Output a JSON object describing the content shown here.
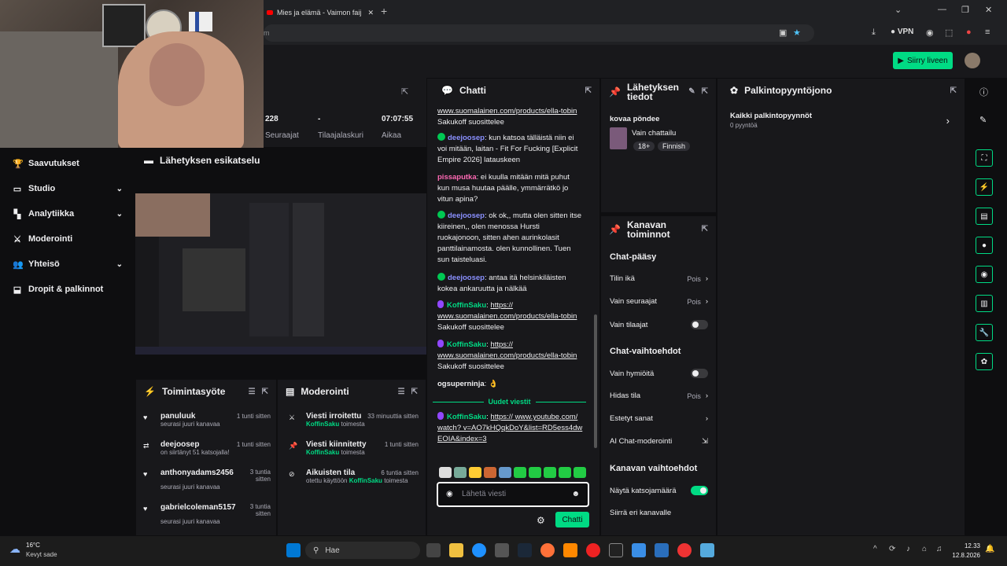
{
  "browser": {
    "tab_title": "Mies ja elämä - Vaimon faij",
    "url": "m",
    "vpn_label": "VPN"
  },
  "header": {
    "go_live": "Siirry liveen"
  },
  "nav": {
    "items": [
      {
        "label": "Saavutukset",
        "icon": "trophy-icon"
      },
      {
        "label": "Studio",
        "icon": "studio-icon"
      },
      {
        "label": "Analytiikka",
        "icon": "analytics-icon"
      },
      {
        "label": "Moderointi",
        "icon": "sword-icon"
      },
      {
        "label": "Yhteisö",
        "icon": "community-icon"
      },
      {
        "label": "Dropit & palkinnot",
        "icon": "drops-icon"
      }
    ]
  },
  "stats": [
    {
      "value": "228",
      "label": "Seuraajat"
    },
    {
      "value": "-",
      "label": "Tilaajalaskuri"
    },
    {
      "value": "07:07:55",
      "label": "Aikaa"
    }
  ],
  "preview": {
    "title": "Lähetyksen esikatselu"
  },
  "activity": {
    "title": "Toimintasyöte",
    "items": [
      {
        "name": "panuluuk",
        "sub": "seurasi juuri kanavaa",
        "time": "1 tunti sitten",
        "icon": "heart-icon"
      },
      {
        "name": "deejoosep",
        "sub": "on siirtänyt 51 katsojalla!",
        "time": "1 tunti sitten",
        "icon": "raid-icon"
      },
      {
        "name": "anthonyadams2456",
        "sub": "seurasi juuri kanavaa",
        "time": "3 tuntia sitten",
        "icon": "heart-icon"
      },
      {
        "name": "gabrielcoleman5157",
        "sub": "seurasi juuri kanavaa",
        "time": "3 tuntia sitten",
        "icon": "heart-icon"
      }
    ]
  },
  "moderation": {
    "title": "Moderointi",
    "items": [
      {
        "title": "Viesti irroitettu",
        "time": "33 minuuttia sitten",
        "actor": "KoffinSaku",
        "suffix": "toimesta"
      },
      {
        "title": "Viesti kiinnitetty",
        "time": "1 tunti sitten",
        "actor": "KoffinSaku",
        "suffix": "toimesta"
      },
      {
        "title": "Aikuisten tila",
        "time": "6 tuntia sitten",
        "actor": "KoffinSaku",
        "prefix": "otettu käyttöön",
        "suffix": "toimesta"
      }
    ]
  },
  "chat": {
    "title": "Chatti",
    "msg0": {
      "link": "www.suomalainen.com/products/ella-tobin",
      "text": " Sakukoff suosittelee"
    },
    "msg1": {
      "user": "deejoosep",
      "text": "kun katsoa tälläistä niin ei voi mitään, laitan - Fit For Fucking [Explicit Empire 2026] latauskeen"
    },
    "msg2": {
      "user": "pissaputka",
      "text": "ei kuulla mitään mitä puhut kun musa huutaa päälle, ymmärrätkö jo vitun apina?"
    },
    "msg3": {
      "user": "deejoosep",
      "text": "ok ok,, mutta olen sitten itse kiireinen,, olen menossa Hursti ruokajonoon, sitten ahen aurinkolasit panttilainamosta. olen kunnollinen. Tuen sun taisteluasi."
    },
    "msg4": {
      "user": "deejoosep",
      "text": "antaa itä helsinkiläisten kokea ankaruutta ja nälkää"
    },
    "msg5": {
      "user": "KoffinSaku",
      "link": "https:// www.suomalainen.com/products/ella-tobin",
      "text": " Sakukoff suosittelee"
    },
    "msg6": {
      "user": "KoffinSaku",
      "link": "https:// www.suomalainen.com/products/ella-tobin",
      "text": " Sakukoff suosittelee"
    },
    "msg7": {
      "user": "ogsuperninja",
      "text": "👌"
    },
    "new_messages": "Uudet viestit",
    "msg8": {
      "user": "KoffinSaku",
      "link": "https:// www.youtube.com/watch? v=AO7kHQqkDoY&list=RD5ess4dwEOIA&index=3"
    },
    "placeholder": "Lähetä viesti",
    "send": "Chatti"
  },
  "stream_info": {
    "title": "Lähetyksen tiedot",
    "stream_title": "kovaa pöndee",
    "category": "Vain chattailu",
    "tags": [
      "18+",
      "Finnish"
    ]
  },
  "channel_actions": {
    "title": "Kanavan toiminnot",
    "sections": [
      {
        "title": "Chat-pääsy",
        "rows": [
          {
            "label": "Tilin ikä",
            "value": "Pois",
            "kind": "arrow"
          },
          {
            "label": "Vain seuraajat",
            "value": "Pois",
            "kind": "arrow"
          },
          {
            "label": "Vain tilaajat",
            "value": "",
            "kind": "toggle-off"
          }
        ]
      },
      {
        "title": "Chat-vaihtoehdot",
        "rows": [
          {
            "label": "Vain hymiöitä",
            "value": "",
            "kind": "toggle-off"
          },
          {
            "label": "Hidas tila",
            "value": "Pois",
            "kind": "arrow"
          },
          {
            "label": "Estetyt sanat",
            "value": "",
            "kind": "arrow"
          },
          {
            "label": "AI Chat-moderointi",
            "value": "",
            "kind": "external"
          }
        ]
      },
      {
        "title": "Kanavan vaihtoehdot",
        "rows": [
          {
            "label": "Näytä katsojamäärä",
            "value": "",
            "kind": "toggle-on"
          },
          {
            "label": "Siirrä eri kanavalle",
            "value": "",
            "kind": "none"
          }
        ]
      }
    ]
  },
  "rewards": {
    "title": "Palkintopyyntöjono",
    "item_title": "Kaikki palkintopyynnöt",
    "item_count": "0 pyyntöä"
  },
  "taskbar": {
    "weather_temp": "16°C",
    "weather_desc": "Kevyt sade",
    "search": "Hae",
    "time": "12.33",
    "date": "12.8.2026"
  },
  "colors": {
    "accent": "#00db84",
    "bg": "#0e0e10",
    "panel": "#18181b"
  }
}
